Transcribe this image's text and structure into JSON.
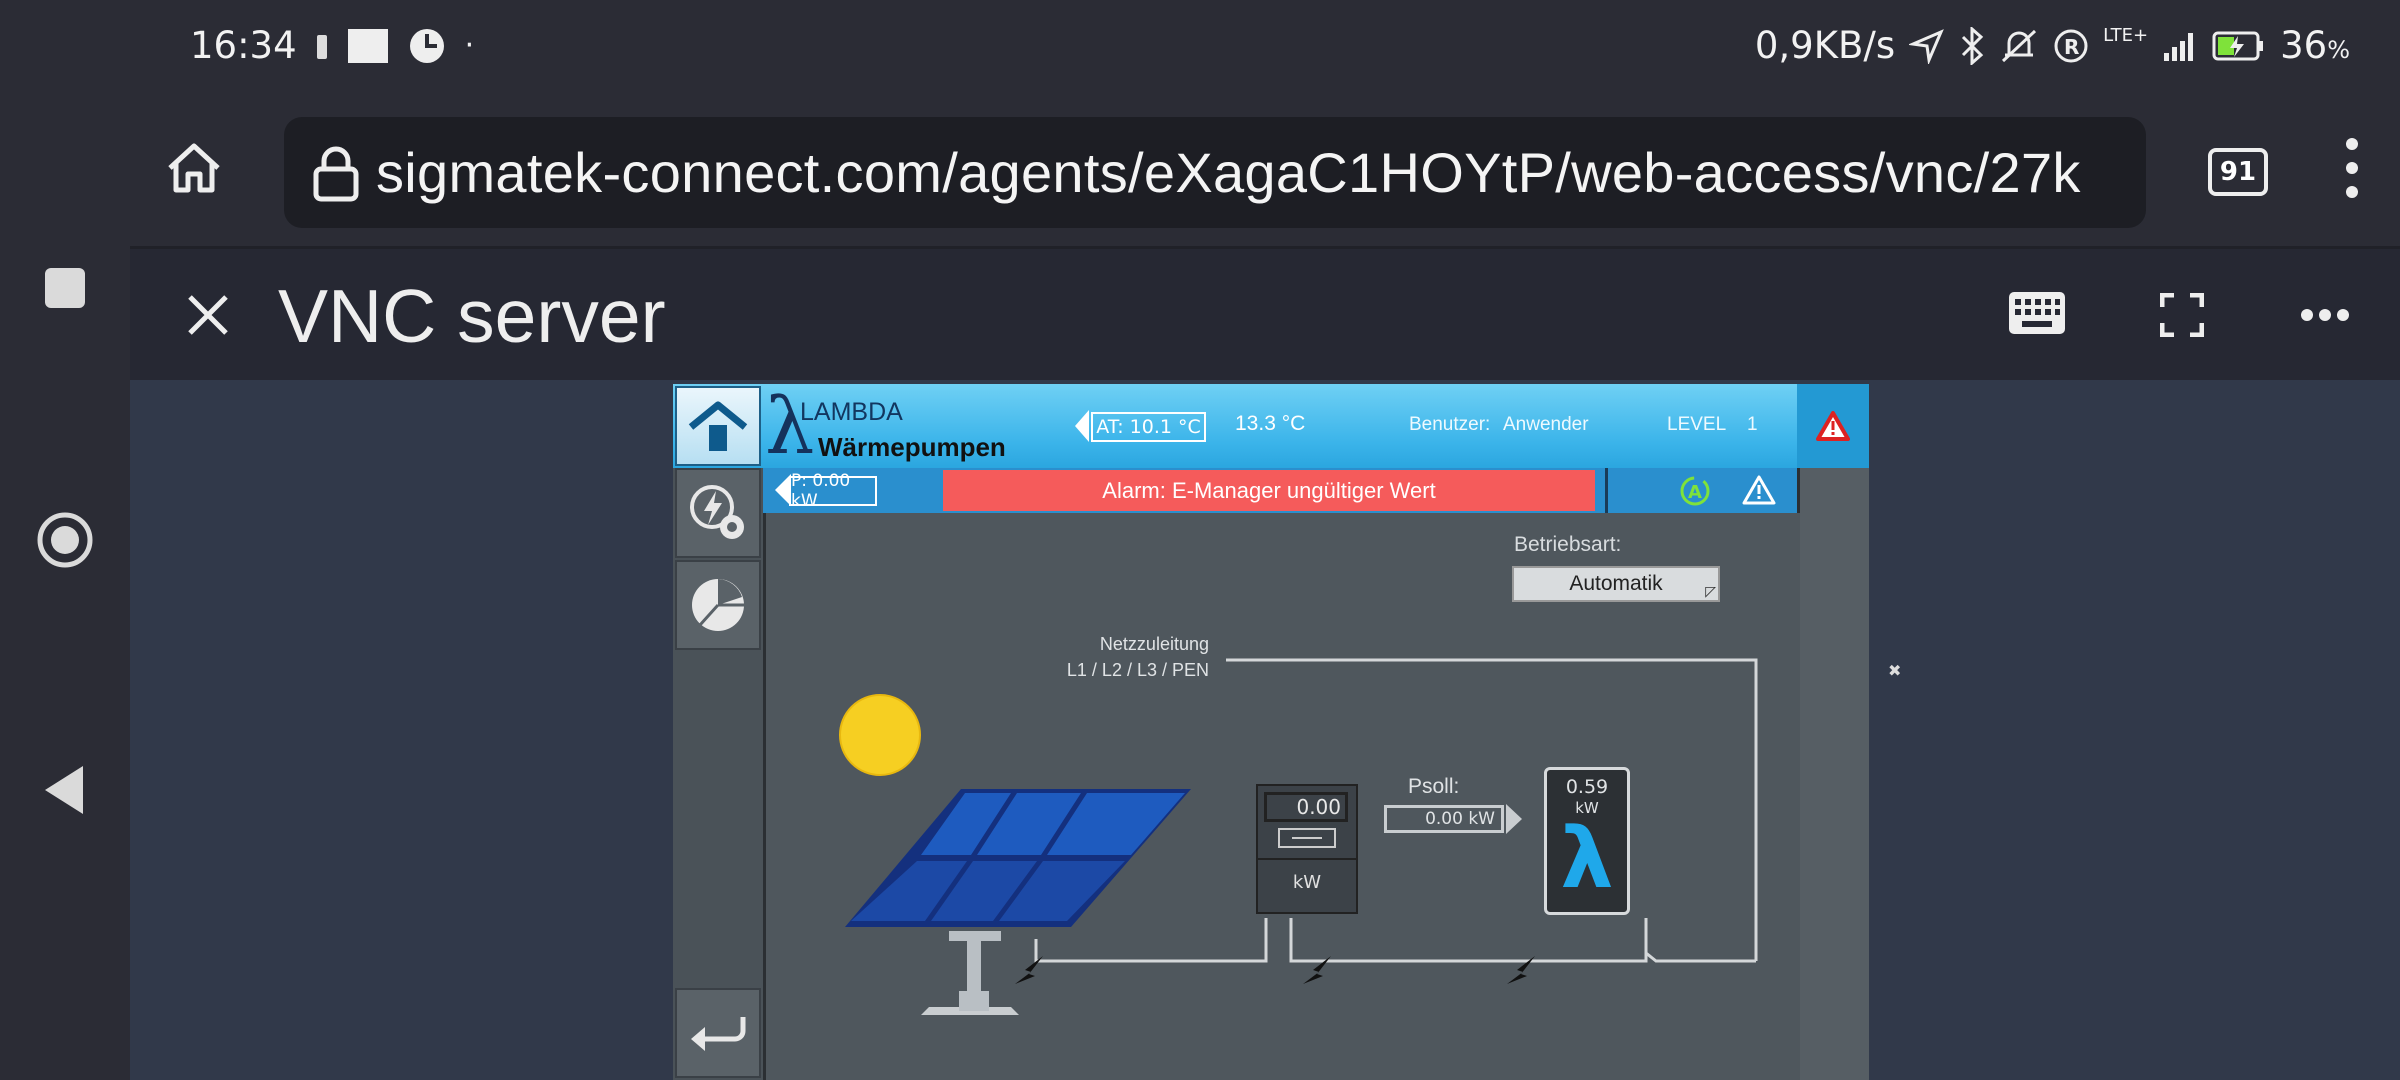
{
  "status_bar": {
    "time": "16:34",
    "net_speed": "0,9KB/s",
    "network": "LTE+",
    "battery": "36",
    "battery_unit": "%"
  },
  "browser": {
    "url": "sigmatek-connect.com/agents/eXagaC1HOYtP/web-access/vnc/27k",
    "tab_count": "91"
  },
  "vnc": {
    "title": "VNC server"
  },
  "hmi": {
    "brand_line1": "LAMBDA",
    "brand_line2": "Wärmepumpen",
    "at_value": "AT: 10.1 °C",
    "temperature": "13.3 °C",
    "user_label": "Benutzer:",
    "user_value": "Anwender",
    "level_label": "LEVEL",
    "level_value": "1",
    "power_value": "P:   0.00 kW",
    "alarm_text": "Alarm:  E-Manager ungültiger Wert",
    "mode_label": "Betriebsart:",
    "mode_value": "Automatik",
    "grid_line1": "Netzzuleitung",
    "grid_line2": "L1 / L2 / L3 / PEN",
    "meter_value": "0.00",
    "meter_unit": "kW",
    "psoll_label": "Psoll:",
    "psoll_value": "0.00  kW",
    "hp_value": "0.59",
    "hp_unit": "kW",
    "hp_symbol": "λ"
  },
  "colors": {
    "hmi_header": "#3bb4ea",
    "alarm_red": "#f55b5b",
    "accent_green": "#7fe23a",
    "lambda_blue": "#1fa8ea"
  }
}
